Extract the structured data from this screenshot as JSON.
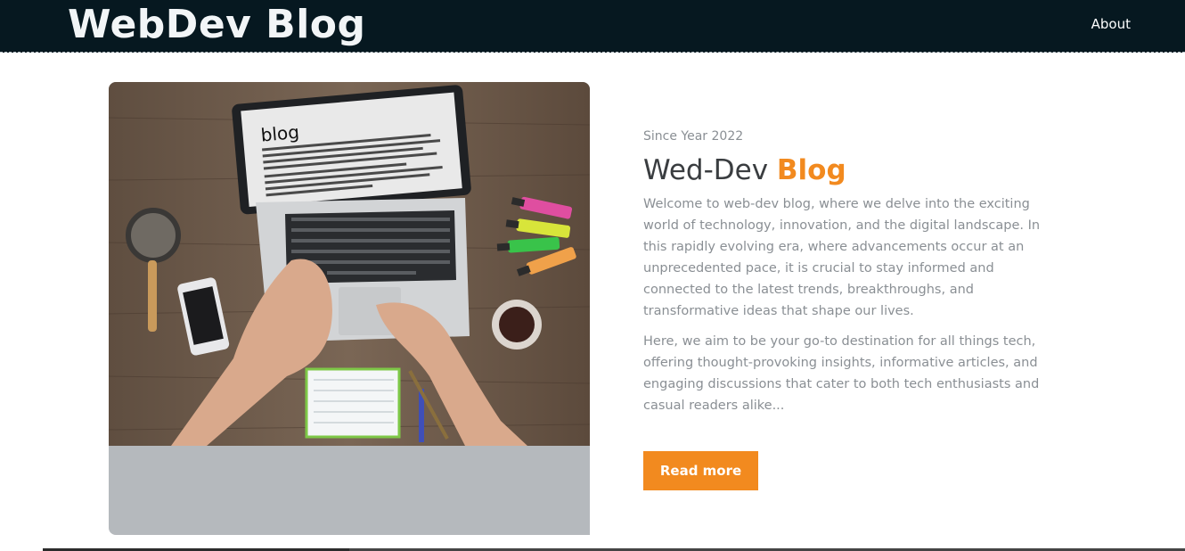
{
  "header": {
    "brand": "WebDev Blog",
    "nav": {
      "about_label": "About"
    }
  },
  "hero": {
    "eyebrow": "Since Year 2022",
    "title_main": "Wed-Dev ",
    "title_accent": "Blog",
    "paragraphs": [
      "Welcome to web-dev blog, where we delve into the exciting world of technology, innovation, and the digital landscape. In this rapidly evolving era, where advancements occur at an unprecedented pace, it is crucial to stay informed and connected to the latest trends, breakthroughs, and transformative ideas that shape our lives.",
      "Here, we aim to be your go-to destination for all things tech, offering thought-provoking insights, informative articles, and engaging discussions that cater to both tech enthusiasts and casual readers alike..."
    ],
    "cta_label": "Read more",
    "image": {
      "screen_heading": "blog"
    }
  },
  "colors": {
    "navbar": "#061820",
    "accent": "#f28a1f",
    "muted_text": "#8a8f94",
    "heading_text": "#3a3d40",
    "card_bg": "#b5b9bd"
  }
}
